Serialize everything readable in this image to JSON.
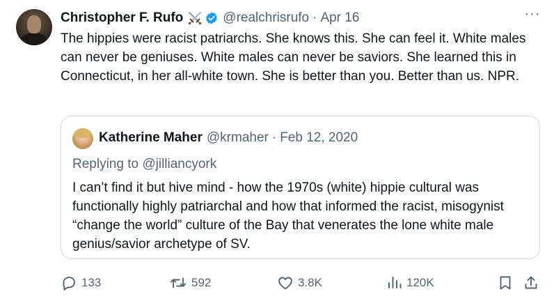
{
  "tweet": {
    "author_name": "Christopher F. Rufo",
    "handle": "@realchrisrufo",
    "separator": "·",
    "date": "Apr 16",
    "more_label": "···",
    "text": "The hippies were racist patriarchs. She knows this. She can feel it. White males can never be geniuses. White males can never be saviors. She learned this in Connecticut, in her all-white town. She is better than you. Better than us. NPR."
  },
  "quoted": {
    "author_name": "Katherine Maher",
    "handle": "@krmaher",
    "separator": "·",
    "date": "Feb 12, 2020",
    "replying_to": "Replying to @jilliancyork",
    "text": "I can’t find it but hive mind - how the 1970s (white) hippie cultural was functionally highly patriarchal and how that informed the racist, misogynist “change the world” culture of the Bay that venerates the lone white male genius/savior archetype of SV."
  },
  "actions": {
    "replies": "133",
    "reposts": "592",
    "likes": "3.8K",
    "views": "120K"
  },
  "colors": {
    "text": "#0f1419",
    "secondary": "#536471",
    "verified": "#1d9bf0",
    "border": "#cfd9de"
  },
  "icons": {
    "swords": "crossed-swords-icon",
    "verified": "verified-badge-icon",
    "more": "more-icon",
    "reply": "reply-icon",
    "repost": "repost-icon",
    "like": "heart-icon",
    "views": "views-icon",
    "bookmark": "bookmark-icon",
    "share": "share-icon"
  }
}
